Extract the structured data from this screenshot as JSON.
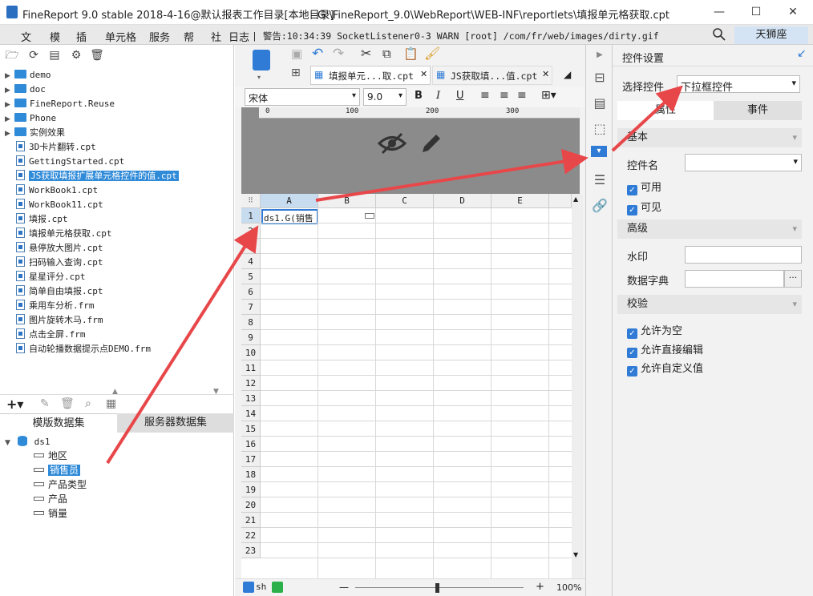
{
  "window": {
    "title": "FineReport 9.0 stable 2018-4-16@默认报表工作目录[本地目录]",
    "path": "G:\\FineReport_9.0\\WebReport\\WEB-INF\\reportlets\\填报单元格获取.cpt",
    "minimize": "—",
    "maximize": "☐",
    "close": "✕"
  },
  "menu": {
    "items": [
      "文",
      "模",
      "插",
      "单元格",
      "服务",
      "帮",
      "社"
    ],
    "log_label": "日志",
    "log_text": "| 警告:10:34:39 SocketListener0-3 WARN [root] /com/fr/web/images/dirty.gif",
    "user": "天狮座"
  },
  "tree": {
    "folders": [
      "demo",
      "doc",
      "FineReport.Reuse",
      "Phone",
      "实例效果"
    ],
    "files": [
      "3D卡片翻转.cpt",
      "GettingStarted.cpt",
      "JS获取填报扩展单元格控件的值.cpt",
      "WorkBook1.cpt",
      "WorkBook11.cpt",
      "填报.cpt",
      "填报单元格获取.cpt",
      "悬停放大图片.cpt",
      "扫码输入查询.cpt",
      "星星评分.cpt",
      "简单自由填报.cpt",
      "乘用车分析.frm",
      "图片旋转木马.frm",
      "点击全屏.frm",
      "自动轮播数据提示点DEMO.frm"
    ],
    "selected_file": "JS获取填报扩展单元格控件的值.cpt"
  },
  "dataset": {
    "tabs": [
      "模版数据集",
      "服务器数据集"
    ],
    "name": "ds1",
    "fields": [
      "地区",
      "销售员",
      "产品类型",
      "产品",
      "销量"
    ],
    "selected_field": "销售员"
  },
  "editor": {
    "tabs": [
      "填报单元...取.cpt",
      "JS获取填...值.cpt"
    ],
    "font": "宋体",
    "font_size": "9.0",
    "ruler_marks": [
      "0",
      "100",
      "200",
      "300"
    ],
    "columns": [
      "A",
      "B",
      "C",
      "D",
      "E"
    ],
    "rows": [
      "1",
      "2",
      "3",
      "4",
      "5",
      "6",
      "7",
      "8",
      "9",
      "10",
      "11",
      "12",
      "13",
      "14",
      "15",
      "16",
      "17",
      "18",
      "19",
      "20",
      "21",
      "22",
      "23"
    ],
    "cell_a1": "ds1.G(销售",
    "zoom": "100%",
    "sheet_tab": "sh"
  },
  "widget_panel": {
    "title": "控件设置",
    "select_label": "选择控件",
    "select_value": "下拉框控件",
    "tabs": [
      "属性",
      "事件"
    ],
    "section_basic": "基本",
    "name_label": "控件名",
    "enabled_label": "可用",
    "visible_label": "可见",
    "section_advanced": "高级",
    "watermark_label": "水印",
    "dict_label": "数据字典",
    "section_validate": "校验",
    "allow_empty": "允许为空",
    "allow_direct_edit": "允许直接编辑",
    "allow_custom": "允许自定义值"
  },
  "colors": {
    "accent": "#2f8ad8",
    "arrow": "#e8474a"
  }
}
